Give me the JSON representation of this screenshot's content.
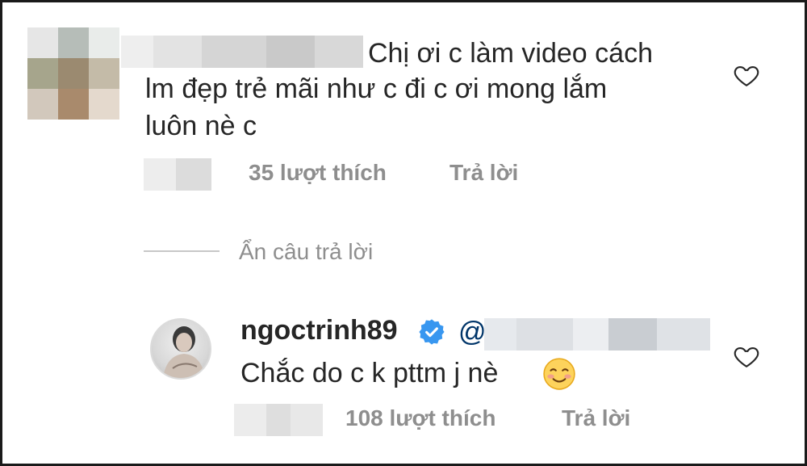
{
  "first_comment": {
    "text_line1": "Chị ơi c làm video cách",
    "text_line2": "lm đẹp trẻ mãi như c đi c ơi mong lắm",
    "text_line3": "luôn nè c",
    "likes": "35 lượt thích",
    "reply": "Trả lời"
  },
  "hide_replies": "Ẩn câu trả lời",
  "reply_comment": {
    "username": "ngoctrinh89",
    "mention_prefix": "@",
    "text": "Chắc do c k pttm j nè",
    "emoji": "smiling-face-icon",
    "likes": "108 lượt thích",
    "reply": "Trả lời"
  },
  "colors": {
    "text": "#262626",
    "meta": "#8e8e8e",
    "verified": "#3897f0",
    "mention": "#003569"
  }
}
